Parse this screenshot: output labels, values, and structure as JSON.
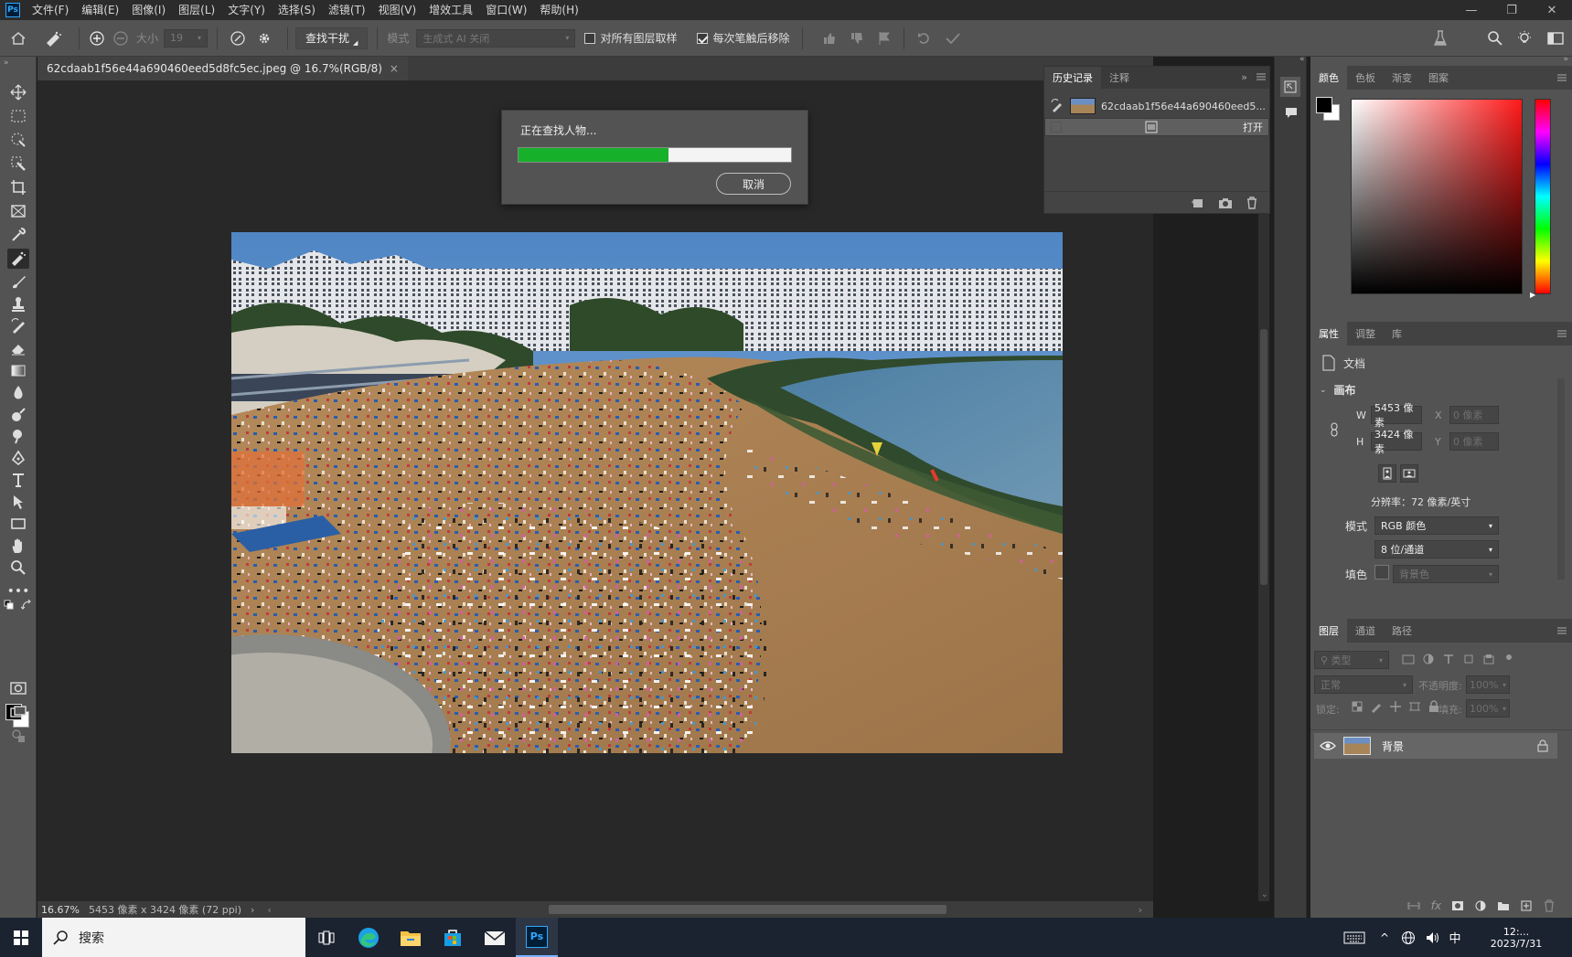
{
  "app": {
    "logo": "Ps"
  },
  "menu": [
    "文件(F)",
    "编辑(E)",
    "图像(I)",
    "图层(L)",
    "文字(Y)",
    "选择(S)",
    "滤镜(T)",
    "视图(V)",
    "增效工具",
    "窗口(W)",
    "帮助(H)"
  ],
  "window_controls": {
    "minimize": "—",
    "restore": "❐",
    "close": "✕"
  },
  "options": {
    "size_label": "大小",
    "size_value": "19",
    "find_distractions": "查找干扰",
    "mode_label": "模式",
    "mode_value": "生成式 AI 关闭",
    "sample_all_layers": "对所有图层取样",
    "sample_all_checked": false,
    "remove_after_stroke": "每次笔触后移除",
    "remove_after_checked": true
  },
  "document": {
    "tab_title": "62cdaab1f56e44a690460eed5d8fc5ec.jpeg @ 16.7%(RGB/8)",
    "close": "×"
  },
  "dialog": {
    "message": "正在查找人物...",
    "progress": 0.55,
    "cancel": "取消"
  },
  "history": {
    "tabs": [
      "历史记录",
      "注释"
    ],
    "snapshot": "62cdaab1f56e44a690460eed5...",
    "items": [
      "打开"
    ]
  },
  "color_panel": {
    "tabs": [
      "颜色",
      "色板",
      "渐变",
      "图案"
    ],
    "fg": "#000000",
    "bg": "#ffffff",
    "hue": "#ff1a1a"
  },
  "properties": {
    "tabs": [
      "属性",
      "调整",
      "库"
    ],
    "doc_label": "文档",
    "canvas_section": "画布",
    "w_label": "W",
    "w_value": "5453 像素",
    "h_label": "H",
    "h_value": "3424 像素",
    "x_label": "X",
    "x_placeholder": "0 像素",
    "y_label": "Y",
    "y_placeholder": "0 像素",
    "resolution": "分辨率：72 像素/英寸",
    "mode_label": "模式",
    "mode_value": "RGB 颜色",
    "depth_value": "8 位/通道",
    "fill_label": "填色",
    "fill_value": "背景色"
  },
  "layers": {
    "tabs": [
      "图层",
      "通道",
      "路径"
    ],
    "filter_placeholder": "类型",
    "blend_mode": "正常",
    "opacity_label": "不透明度:",
    "opacity_value": "100%",
    "lock_label": "锁定:",
    "fill_label": "填充:",
    "fill_value": "100%",
    "layer_name": "背景",
    "fx": "fx"
  },
  "status": {
    "zoom": "16.67%",
    "info": "5453 像素 x 3424 像素 (72 ppi)"
  },
  "taskbar": {
    "search_placeholder": "搜索",
    "ime": "中",
    "time": "12:...",
    "date": "2023/7/31"
  }
}
